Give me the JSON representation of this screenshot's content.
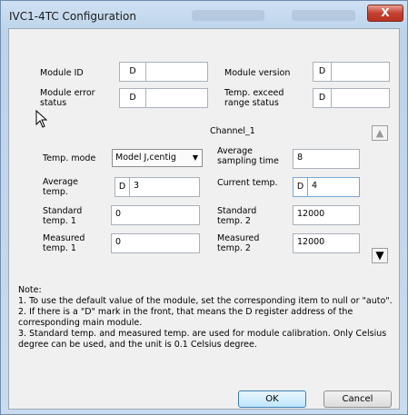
{
  "window": {
    "title": "IVC1-4TC Configuration",
    "close_label": "X"
  },
  "module": {
    "id_label": "Module ID",
    "id_prefix": "D",
    "id_value": "",
    "version_label": "Module version",
    "version_prefix": "D",
    "version_value": "",
    "error_label": "Module error status",
    "error_prefix": "D",
    "error_value": "",
    "exceed_label": "Temp. exceed range status",
    "exceed_prefix": "D",
    "exceed_value": ""
  },
  "channel": {
    "name": "Channel_1",
    "temp_mode_label": "Temp. mode",
    "temp_mode_value": "Model J,centig",
    "avg_sampling_label": "Average sampling time",
    "avg_sampling_value": "8",
    "avg_temp_label": "Average temp.",
    "avg_temp_prefix": "D",
    "avg_temp_value": "3",
    "current_temp_label": "Current temp.",
    "current_temp_prefix": "D",
    "current_temp_value": "4",
    "std1_label": "Standard temp. 1",
    "std1_value": "0",
    "std2_label": "Standard temp. 2",
    "std2_value": "12000",
    "meas1_label": "Measured temp. 1",
    "meas1_value": "0",
    "meas2_label": "Measured temp. 2",
    "meas2_value": "12000"
  },
  "note": {
    "heading": "Note:",
    "line1": "1. To use the default value of the module, set the corresponding item to null or \"auto\".",
    "line2": "2. If there is a \"D\" mark in the front, that means the D register address of the corresponding main module.",
    "line3": "3. Standard temp. and measured temp. are used for module calibration. Only Celsius degree can be used, and the unit is 0.1 Celsius degree."
  },
  "buttons": {
    "ok": "OK",
    "cancel": "Cancel"
  }
}
